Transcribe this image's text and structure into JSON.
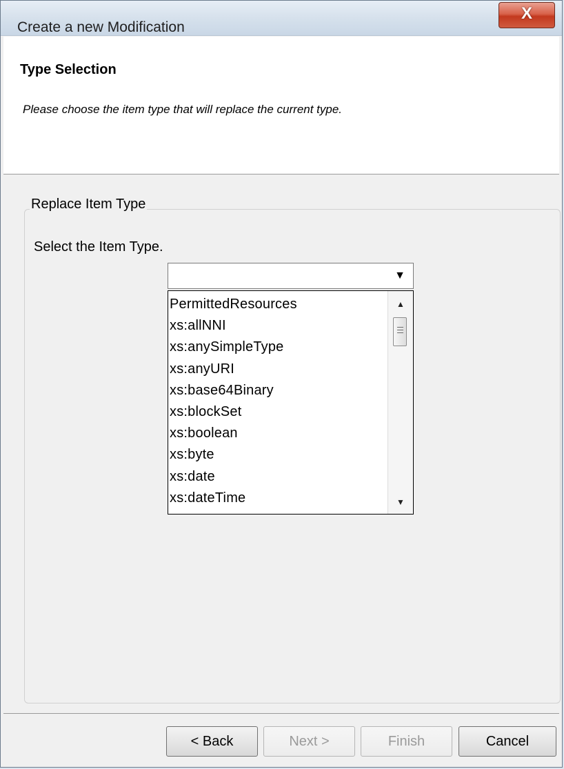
{
  "window": {
    "title": "Create a new Modification",
    "close_label": "X"
  },
  "header": {
    "title": "Type Selection",
    "subtitle": "Please choose the item type that will replace the current type."
  },
  "group": {
    "legend": "Replace Item Type",
    "select_label": "Select the Item Type."
  },
  "combo": {
    "value": "",
    "options": [
      "PermittedResources",
      "xs:allNNI",
      "xs:anySimpleType",
      "xs:anyURI",
      "xs:base64Binary",
      "xs:blockSet",
      "xs:boolean",
      "xs:byte",
      "xs:date",
      "xs:dateTime"
    ]
  },
  "footer": {
    "back_label": "< Back",
    "next_label": "Next >",
    "finish_label": "Finish",
    "cancel_label": "Cancel"
  }
}
